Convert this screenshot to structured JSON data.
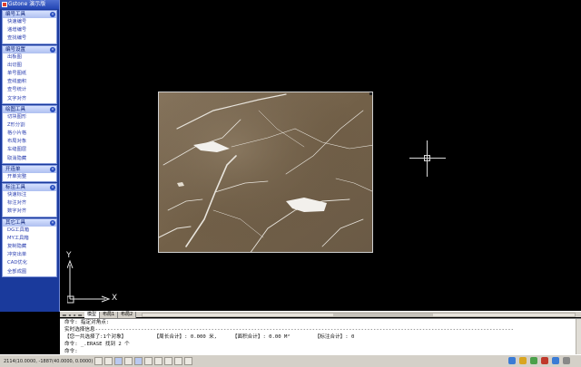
{
  "panel": {
    "title": "Gstone 演示版",
    "groups": [
      {
        "header": "编号工具",
        "items": [
          "快速编号",
          "递增编号",
          "查找编号"
        ]
      },
      {
        "header": "编号设置",
        "items": [
          "出板图",
          "出切图",
          "单号图纸",
          "查线面积",
          "查号统计",
          "文字对齐"
        ]
      },
      {
        "header": "绘图工具",
        "items": [
          "切块图形",
          "Z形分割",
          "格小片格",
          "布局对象",
          "车缝图层",
          "取消隐藏"
        ]
      },
      {
        "header": "开连单",
        "items": [
          "开单完整"
        ]
      },
      {
        "header": "标注工具",
        "items": [
          "快速标注",
          "标注对齐",
          "数字对齐"
        ]
      },
      {
        "header": "其它工具",
        "items": [
          "DG工具箱",
          "MY工具箱",
          "复制隐藏",
          "冲突出单",
          "CAD优化",
          "全部成图"
        ]
      }
    ]
  },
  "ucs": {
    "x_label": "X",
    "y_label": "Y"
  },
  "layout_tabs": {
    "nav": [
      "◂◂",
      "◂",
      "▸",
      "▸▸"
    ],
    "tabs": [
      "模型",
      "布局1",
      "布局2"
    ],
    "active": "模型"
  },
  "command_window": {
    "lines": [
      "命令: 指定对角点:",
      "实时选择信息-----------------------------------------------------------------------------------------------------------------------------------------",
      "【您一共选择了:1个对象】         【周长合计】: 0.000 米,     【面积合计】: 0.00 M²        【标注合计】: 0",
      "命令: _.ERASE 找到 2 个",
      "命令:"
    ]
  },
  "status_bar": {
    "coords": "2114(10.0000, -1887(40.0000, 0.0000)",
    "buttons": [
      "snap",
      "grid",
      "ortho",
      "polar",
      "osnap",
      "otrack",
      "ducs",
      "dyn",
      "lwt",
      "model"
    ]
  },
  "colors": {
    "panel_bg": "#1a3a9c",
    "group_item_text": "#2a3eb0",
    "canvas_bg": "#000000",
    "marble_base": "#7b6a54"
  },
  "image": {
    "subject": "marble-texture"
  }
}
